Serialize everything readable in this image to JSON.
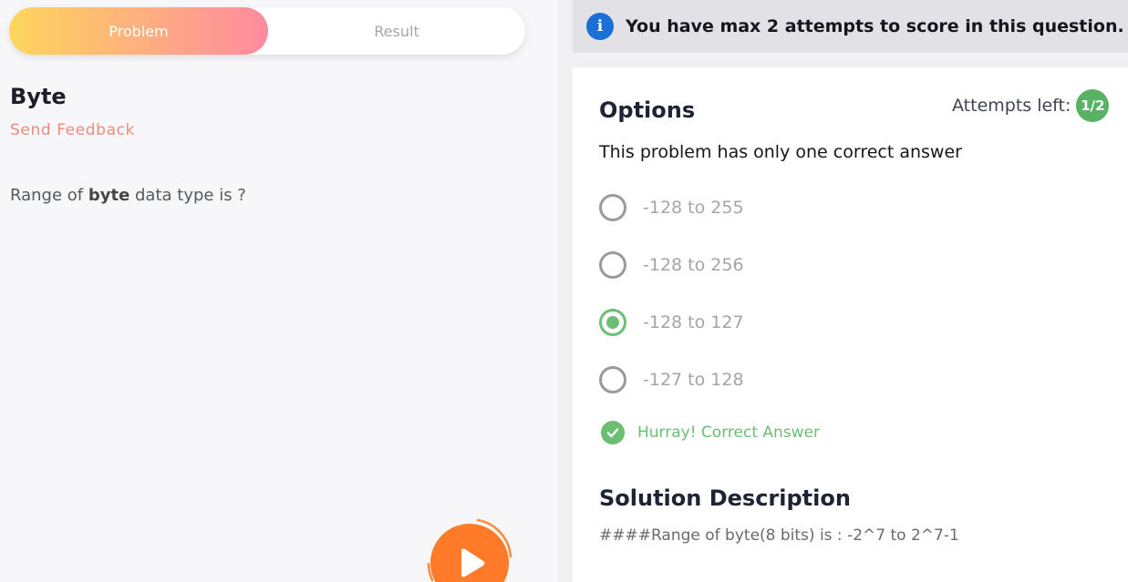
{
  "tabs": {
    "problem": "Problem",
    "result": "Result"
  },
  "problem": {
    "title": "Byte",
    "feedback_link": "Send Feedback",
    "question_prefix": "Range of ",
    "question_bold": "byte",
    "question_suffix": " data type is ?"
  },
  "banner": {
    "icon": "info-icon",
    "text": "You have max 2 attempts to score in this question."
  },
  "options_section": {
    "title": "Options",
    "attempts_label": "Attempts left:",
    "attempts_value": "1/2",
    "instruction": "This problem has only one correct answer",
    "options": [
      {
        "label": "-128 to 255",
        "selected": false
      },
      {
        "label": "-128 to 256",
        "selected": false
      },
      {
        "label": "-128 to 127",
        "selected": true
      },
      {
        "label": "-127 to 128",
        "selected": false
      }
    ],
    "result_text": "Hurray! Correct Answer"
  },
  "solution": {
    "title": "Solution Description",
    "text": "####Range of byte(8 bits) is : -2^7 to 2^7-1"
  },
  "colors": {
    "accent_green": "#6cbe72",
    "info_blue": "#1c6fd6",
    "play_orange": "#ff7b2a",
    "feedback_pink": "#f08a7e"
  }
}
